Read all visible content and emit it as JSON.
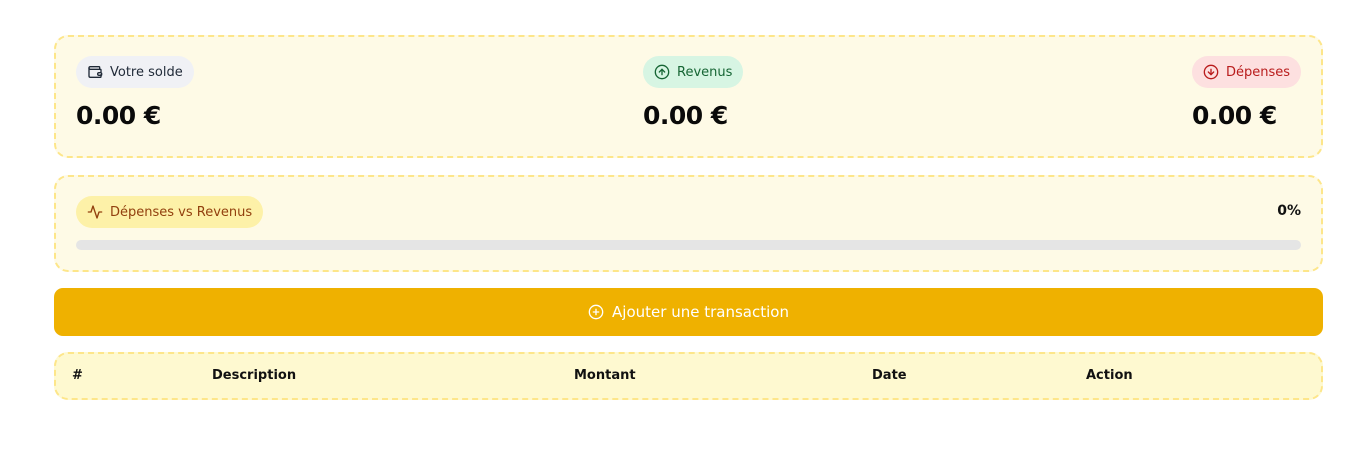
{
  "summary": {
    "balance": {
      "label": "Votre solde",
      "amount": "0.00 €",
      "icon": "wallet-icon"
    },
    "income": {
      "label": "Revenus",
      "amount": "0.00 €",
      "icon": "arrow-up-circle-icon",
      "color": "#166534"
    },
    "expenses": {
      "label": "Dépenses",
      "amount": "0.00 €",
      "icon": "arrow-down-circle-icon",
      "color": "#b91c1c"
    }
  },
  "ratio": {
    "label": "Dépenses vs Revenus",
    "icon": "activity-icon",
    "percent_text": "0%",
    "progress": 0
  },
  "actions": {
    "add_transaction_label": "Ajouter une transaction",
    "add_icon": "plus-circle-icon",
    "accent_color": "#efb100"
  },
  "table": {
    "columns": [
      "#",
      "Description",
      "Montant",
      "Date",
      "Action"
    ],
    "rows": []
  }
}
